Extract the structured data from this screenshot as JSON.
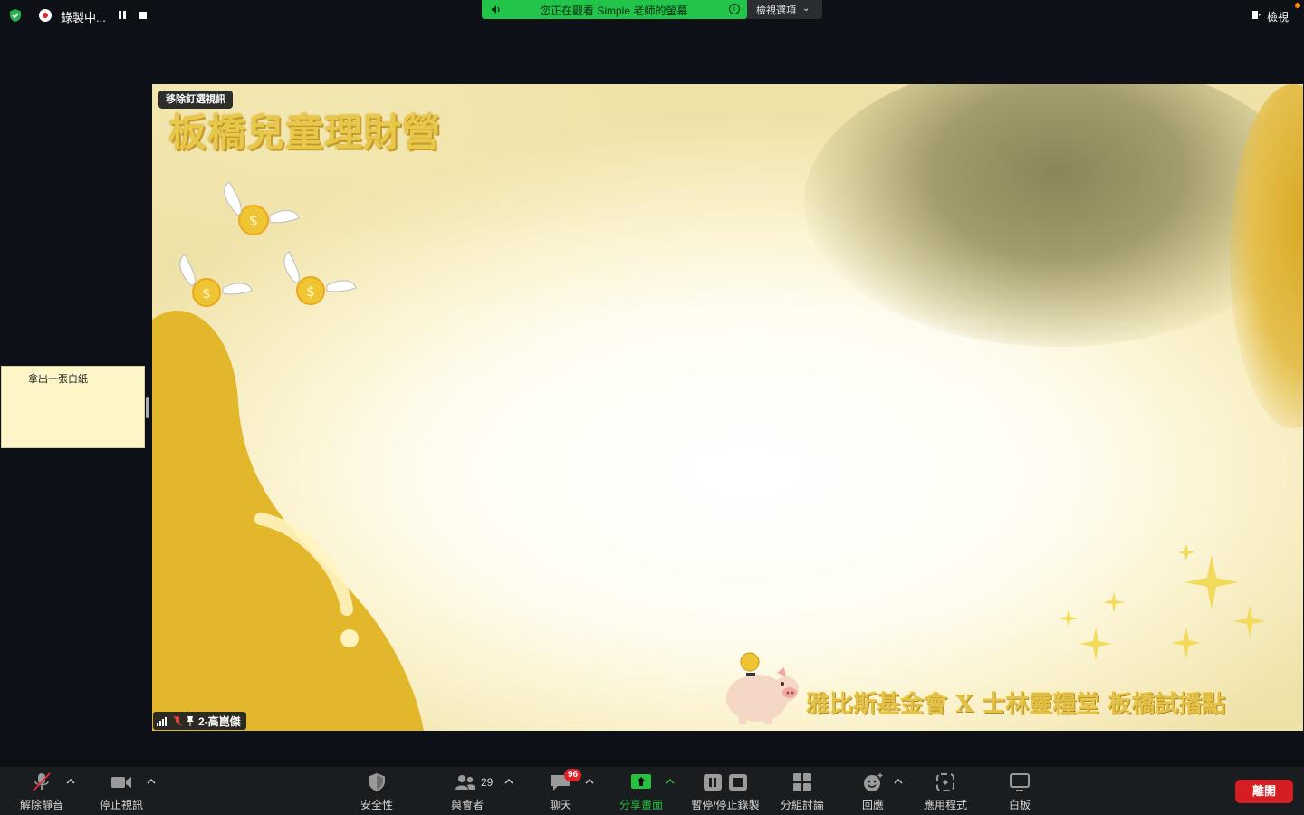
{
  "top": {
    "recording_label": "錄製中...",
    "share_banner": "您正在觀看 Simple 老師的螢幕",
    "view_options_label": "檢視選項",
    "view_label": "檢視"
  },
  "stage": {
    "pin_badge": "移除釘選視訊",
    "title_graphic": "板橋兒童理財營",
    "footer_graphic": "雅比斯基金會 X 士林靈糧堂 板橋試播點",
    "participant_name": "2-高崑傑"
  },
  "side_tile": {
    "text": "拿出一張白紙"
  },
  "toolbar": {
    "unmute_label": "解除靜音",
    "stop_video_label": "停止視訊",
    "security_label": "安全性",
    "participants_label": "與會者",
    "participants_count": "29",
    "chat_label": "聊天",
    "chat_badge": "96",
    "share_label": "分享畫面",
    "record_label": "暫停/停止錄製",
    "breakout_label": "分組討論",
    "reactions_label": "回應",
    "apps_label": "應用程式",
    "whiteboard_label": "白板",
    "leave_label": "離開"
  },
  "colors": {
    "share_green": "#23c44a",
    "leave_red": "#d51d24",
    "badge_red": "#e0222a",
    "background": "#0d1117",
    "toolbar_bg": "#1a1d20"
  },
  "icons": [
    "shield-check-icon",
    "record-icon",
    "pause-icon",
    "stop-icon",
    "speaker-icon",
    "info-icon",
    "chevron-down-icon",
    "view-icon",
    "mic-off-icon",
    "video-icon",
    "security-icon",
    "participants-icon",
    "chat-icon",
    "share-screen-icon",
    "record-pause-stop-icon",
    "breakout-icon",
    "reaction-icon",
    "apps-icon",
    "whiteboard-icon",
    "signal-icon",
    "pin-icon"
  ]
}
